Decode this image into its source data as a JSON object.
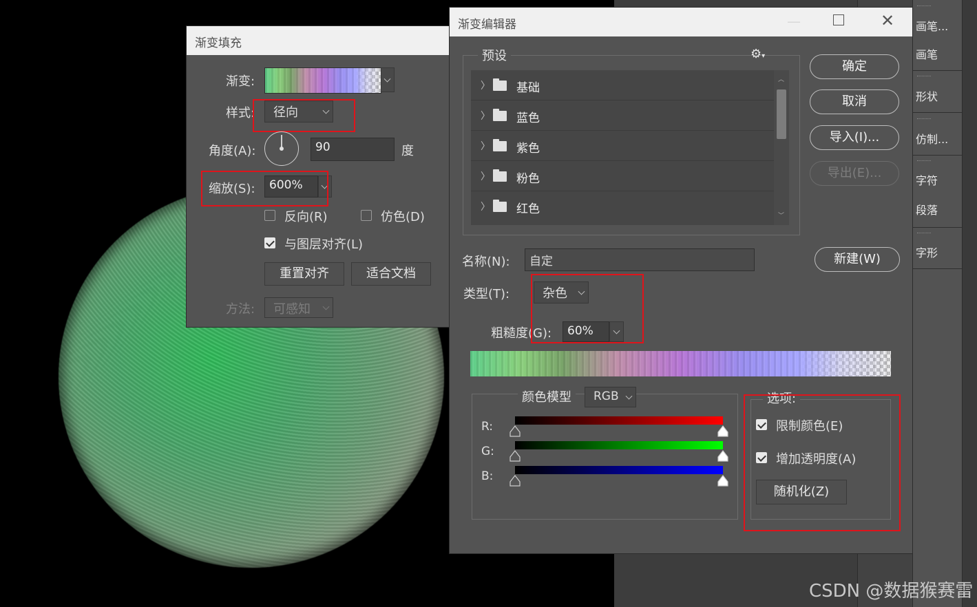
{
  "gradient_fill": {
    "title": "渐变填充",
    "gradient_label": "渐变:",
    "style_label": "样式:",
    "style_value": "径向",
    "angle_label": "角度(A):",
    "angle_value": "90",
    "angle_unit": "度",
    "scale_label": "缩放(S):",
    "scale_value": "600%",
    "reverse_label": "反向(R)",
    "dither_label": "仿色(D)",
    "align_label": "与图层对齐(L)",
    "reset_align_button": "重置对齐",
    "fit_document_button": "适合文档",
    "method_label": "方法:",
    "method_value": "可感知",
    "reverse_checked": false,
    "dither_checked": false,
    "align_checked": true
  },
  "gradient_editor": {
    "title": "渐变编辑器",
    "presets_label": "预设",
    "presets": [
      "基础",
      "蓝色",
      "紫色",
      "粉色",
      "红色"
    ],
    "ok_button": "确定",
    "cancel_button": "取消",
    "import_button": "导入(I)...",
    "export_button": "导出(E)...",
    "name_label": "名称(N):",
    "name_value": "自定",
    "new_button": "新建(W)",
    "type_label": "类型(T):",
    "type_value": "杂色",
    "roughness_label": "粗糙度(G):",
    "roughness_value": "60%",
    "color_model_label": "颜色模型",
    "color_model_value": "RGB",
    "channel_r": "R:",
    "channel_g": "G:",
    "channel_b": "B:",
    "options_label": "选项:",
    "restrict_colors_label": "限制颜色(E)",
    "add_transparency_label": "增加透明度(A)",
    "randomize_button": "随机化(Z)",
    "restrict_colors_checked": true,
    "add_transparency_checked": true
  },
  "side_panels": {
    "items": [
      "画笔...",
      "画笔",
      "形状",
      "仿制...",
      "字符",
      "段落",
      "字形"
    ]
  },
  "watermark": "CSDN @数据猴赛雷",
  "colors": {
    "panel_bg": "#535353",
    "highlight_red": "#e0141b",
    "title_bar": "#f0f0f0"
  }
}
